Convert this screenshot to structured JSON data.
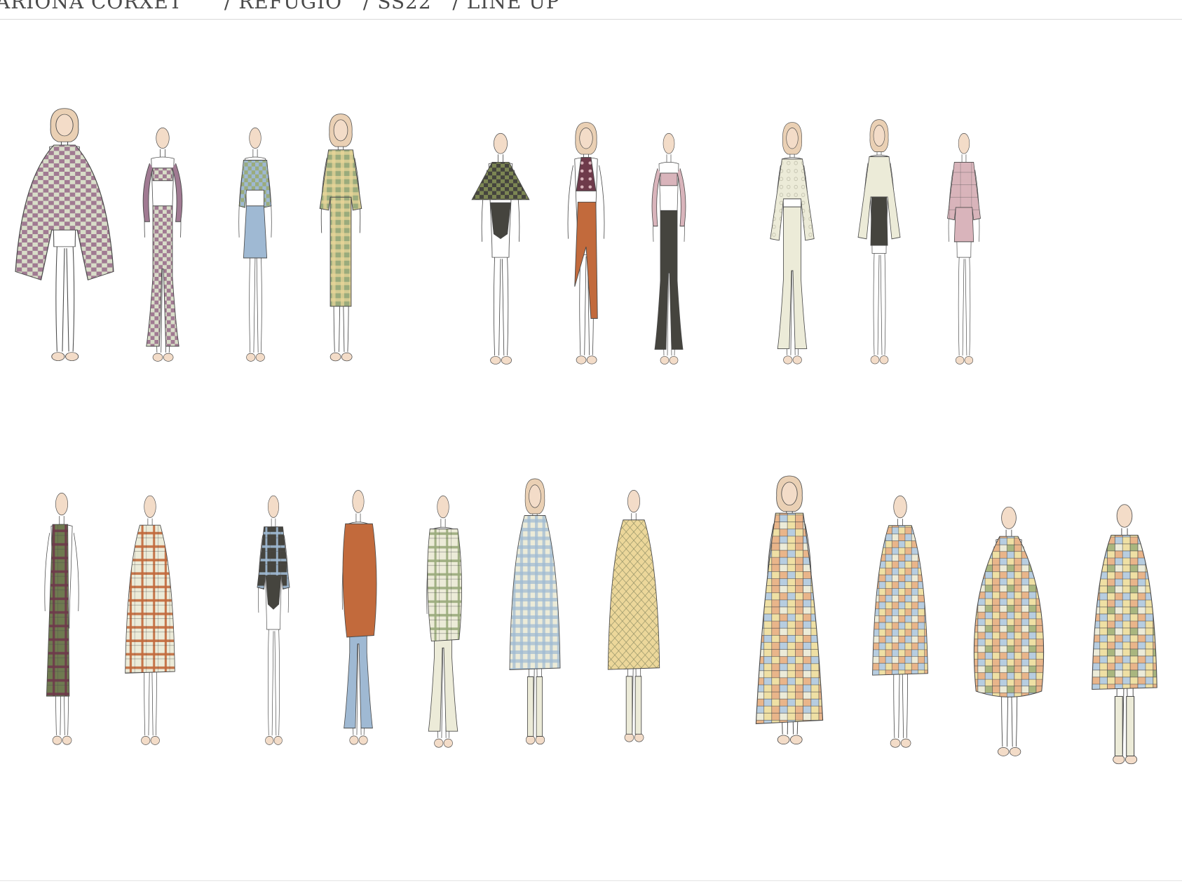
{
  "header": {
    "designer": "ARIONA CORXET",
    "collection": "REFUGIO",
    "season": "SS22",
    "section": "LINE UP",
    "separator": "/"
  },
  "palette": {
    "skin": "#f3dcc8",
    "hair": "#ead0b4",
    "line": "#4a4a4a",
    "mauve": "#a07a92",
    "check_light": "#d8ddc8",
    "sage": "#9aab7c",
    "olive": "#7c8653",
    "butter": "#ecd79a",
    "rust": "#c26a3c",
    "sky": "#9fb9d3",
    "charcoal": "#45443e",
    "plum": "#6e3a4a",
    "blush": "#d9b4bb",
    "cream": "#ecebd8",
    "tartan_green": "#6f7a50",
    "patch_peach": "#e9b58a",
    "patch_blue": "#b7cde0",
    "patch_yellow": "#efe0a4",
    "patch_green": "#a9b67f"
  },
  "looks": [
    {
      "id": "look-01",
      "top": "poncho",
      "bottom": "none",
      "c1": "mauve",
      "c2": "check_light",
      "pattern": "check",
      "hair": true
    },
    {
      "id": "look-02",
      "top": "bra",
      "bottom": "flare",
      "c1": "mauve",
      "c2": "check_light",
      "pattern": "check",
      "hair": false
    },
    {
      "id": "look-03",
      "top": "crop",
      "bottom": "skirt",
      "c1": "sage",
      "c2": "sky",
      "pattern": "check",
      "hair": false
    },
    {
      "id": "look-04",
      "top": "shirt",
      "bottom": "pencil",
      "c1": "butter",
      "c2": "sage",
      "pattern": "gingham",
      "hair": true
    },
    {
      "id": "look-05",
      "top": "cape",
      "bottom": "bodysuit",
      "c1": "olive",
      "c2": "charcoal",
      "pattern": "check",
      "hair": false
    },
    {
      "id": "look-06",
      "top": "halter",
      "bottom": "drape",
      "c1": "plum",
      "c2": "rust",
      "pattern": "floral",
      "hair": true
    },
    {
      "id": "look-07",
      "top": "bra",
      "bottom": "flare",
      "c1": "blush",
      "c2": "charcoal",
      "pattern": "plain",
      "hair": false
    },
    {
      "id": "look-08",
      "top": "blouse",
      "bottom": "flare",
      "c1": "cream",
      "c2": "cream",
      "pattern": "lace",
      "hair": true
    },
    {
      "id": "look-09",
      "top": "blouse",
      "bottom": "overall",
      "c1": "cream",
      "c2": "charcoal",
      "pattern": "plain",
      "hair": true
    },
    {
      "id": "look-10",
      "top": "shirt",
      "bottom": "shorts",
      "c1": "blush",
      "c2": "blush",
      "pattern": "plaid",
      "hair": false
    },
    {
      "id": "look-11",
      "top": "scarf",
      "bottom": "none",
      "c1": "tartan_green",
      "c2": "plum",
      "pattern": "tartan",
      "hair": false
    },
    {
      "id": "look-12",
      "top": "coat",
      "bottom": "none",
      "c1": "cream",
      "c2": "rust",
      "pattern": "tartan",
      "hair": false
    },
    {
      "id": "look-13",
      "top": "shirt",
      "bottom": "bodysuit",
      "c1": "sky",
      "c2": "charcoal",
      "pattern": "plaid",
      "hair": false
    },
    {
      "id": "look-14",
      "top": "wrap",
      "bottom": "flare",
      "c1": "rust",
      "c2": "sky",
      "pattern": "plain",
      "hair": false
    },
    {
      "id": "look-15",
      "top": "wrap",
      "bottom": "flare",
      "c1": "sage",
      "c2": "cream",
      "pattern": "plaid",
      "hair": false
    },
    {
      "id": "look-16",
      "top": "coat",
      "bottom": "boots",
      "c1": "sky",
      "c2": "cream",
      "pattern": "gingham",
      "hair": true
    },
    {
      "id": "look-17",
      "top": "coat",
      "bottom": "boots",
      "c1": "butter",
      "c2": "cream",
      "pattern": "quilt",
      "hair": false
    },
    {
      "id": "look-18",
      "top": "gown",
      "bottom": "none",
      "c1": "patch_yellow",
      "c2": "patch_peach",
      "pattern": "patch",
      "hair": true
    },
    {
      "id": "look-19",
      "top": "coat",
      "bottom": "none",
      "c1": "patch_peach",
      "c2": "patch_blue",
      "pattern": "patch",
      "hair": false
    },
    {
      "id": "look-20",
      "top": "cocoon",
      "bottom": "none",
      "c1": "patch_green",
      "c2": "patch_peach",
      "pattern": "patch",
      "hair": false
    },
    {
      "id": "look-21",
      "top": "coat",
      "bottom": "boots",
      "c1": "patch_yellow",
      "c2": "patch_green",
      "pattern": "patch",
      "hair": false
    }
  ]
}
